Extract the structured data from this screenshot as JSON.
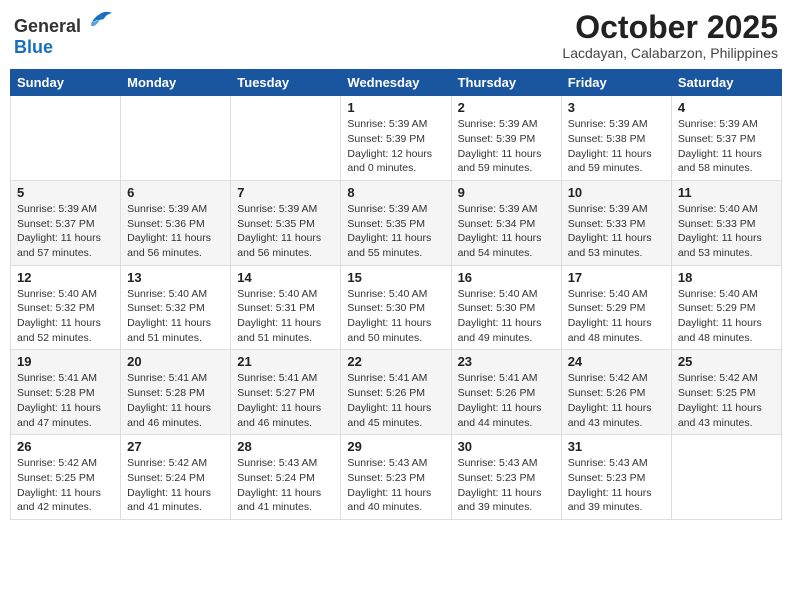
{
  "header": {
    "logo_general": "General",
    "logo_blue": "Blue",
    "month_year": "October 2025",
    "location": "Lacdayan, Calabarzon, Philippines"
  },
  "weekdays": [
    "Sunday",
    "Monday",
    "Tuesday",
    "Wednesday",
    "Thursday",
    "Friday",
    "Saturday"
  ],
  "weeks": [
    [
      {
        "day": "",
        "info": ""
      },
      {
        "day": "",
        "info": ""
      },
      {
        "day": "",
        "info": ""
      },
      {
        "day": "1",
        "info": "Sunrise: 5:39 AM\nSunset: 5:39 PM\nDaylight: 12 hours\nand 0 minutes."
      },
      {
        "day": "2",
        "info": "Sunrise: 5:39 AM\nSunset: 5:39 PM\nDaylight: 11 hours\nand 59 minutes."
      },
      {
        "day": "3",
        "info": "Sunrise: 5:39 AM\nSunset: 5:38 PM\nDaylight: 11 hours\nand 59 minutes."
      },
      {
        "day": "4",
        "info": "Sunrise: 5:39 AM\nSunset: 5:37 PM\nDaylight: 11 hours\nand 58 minutes."
      }
    ],
    [
      {
        "day": "5",
        "info": "Sunrise: 5:39 AM\nSunset: 5:37 PM\nDaylight: 11 hours\nand 57 minutes."
      },
      {
        "day": "6",
        "info": "Sunrise: 5:39 AM\nSunset: 5:36 PM\nDaylight: 11 hours\nand 56 minutes."
      },
      {
        "day": "7",
        "info": "Sunrise: 5:39 AM\nSunset: 5:35 PM\nDaylight: 11 hours\nand 56 minutes."
      },
      {
        "day": "8",
        "info": "Sunrise: 5:39 AM\nSunset: 5:35 PM\nDaylight: 11 hours\nand 55 minutes."
      },
      {
        "day": "9",
        "info": "Sunrise: 5:39 AM\nSunset: 5:34 PM\nDaylight: 11 hours\nand 54 minutes."
      },
      {
        "day": "10",
        "info": "Sunrise: 5:39 AM\nSunset: 5:33 PM\nDaylight: 11 hours\nand 53 minutes."
      },
      {
        "day": "11",
        "info": "Sunrise: 5:40 AM\nSunset: 5:33 PM\nDaylight: 11 hours\nand 53 minutes."
      }
    ],
    [
      {
        "day": "12",
        "info": "Sunrise: 5:40 AM\nSunset: 5:32 PM\nDaylight: 11 hours\nand 52 minutes."
      },
      {
        "day": "13",
        "info": "Sunrise: 5:40 AM\nSunset: 5:32 PM\nDaylight: 11 hours\nand 51 minutes."
      },
      {
        "day": "14",
        "info": "Sunrise: 5:40 AM\nSunset: 5:31 PM\nDaylight: 11 hours\nand 51 minutes."
      },
      {
        "day": "15",
        "info": "Sunrise: 5:40 AM\nSunset: 5:30 PM\nDaylight: 11 hours\nand 50 minutes."
      },
      {
        "day": "16",
        "info": "Sunrise: 5:40 AM\nSunset: 5:30 PM\nDaylight: 11 hours\nand 49 minutes."
      },
      {
        "day": "17",
        "info": "Sunrise: 5:40 AM\nSunset: 5:29 PM\nDaylight: 11 hours\nand 48 minutes."
      },
      {
        "day": "18",
        "info": "Sunrise: 5:40 AM\nSunset: 5:29 PM\nDaylight: 11 hours\nand 48 minutes."
      }
    ],
    [
      {
        "day": "19",
        "info": "Sunrise: 5:41 AM\nSunset: 5:28 PM\nDaylight: 11 hours\nand 47 minutes."
      },
      {
        "day": "20",
        "info": "Sunrise: 5:41 AM\nSunset: 5:28 PM\nDaylight: 11 hours\nand 46 minutes."
      },
      {
        "day": "21",
        "info": "Sunrise: 5:41 AM\nSunset: 5:27 PM\nDaylight: 11 hours\nand 46 minutes."
      },
      {
        "day": "22",
        "info": "Sunrise: 5:41 AM\nSunset: 5:26 PM\nDaylight: 11 hours\nand 45 minutes."
      },
      {
        "day": "23",
        "info": "Sunrise: 5:41 AM\nSunset: 5:26 PM\nDaylight: 11 hours\nand 44 minutes."
      },
      {
        "day": "24",
        "info": "Sunrise: 5:42 AM\nSunset: 5:26 PM\nDaylight: 11 hours\nand 43 minutes."
      },
      {
        "day": "25",
        "info": "Sunrise: 5:42 AM\nSunset: 5:25 PM\nDaylight: 11 hours\nand 43 minutes."
      }
    ],
    [
      {
        "day": "26",
        "info": "Sunrise: 5:42 AM\nSunset: 5:25 PM\nDaylight: 11 hours\nand 42 minutes."
      },
      {
        "day": "27",
        "info": "Sunrise: 5:42 AM\nSunset: 5:24 PM\nDaylight: 11 hours\nand 41 minutes."
      },
      {
        "day": "28",
        "info": "Sunrise: 5:43 AM\nSunset: 5:24 PM\nDaylight: 11 hours\nand 41 minutes."
      },
      {
        "day": "29",
        "info": "Sunrise: 5:43 AM\nSunset: 5:23 PM\nDaylight: 11 hours\nand 40 minutes."
      },
      {
        "day": "30",
        "info": "Sunrise: 5:43 AM\nSunset: 5:23 PM\nDaylight: 11 hours\nand 39 minutes."
      },
      {
        "day": "31",
        "info": "Sunrise: 5:43 AM\nSunset: 5:23 PM\nDaylight: 11 hours\nand 39 minutes."
      },
      {
        "day": "",
        "info": ""
      }
    ]
  ]
}
